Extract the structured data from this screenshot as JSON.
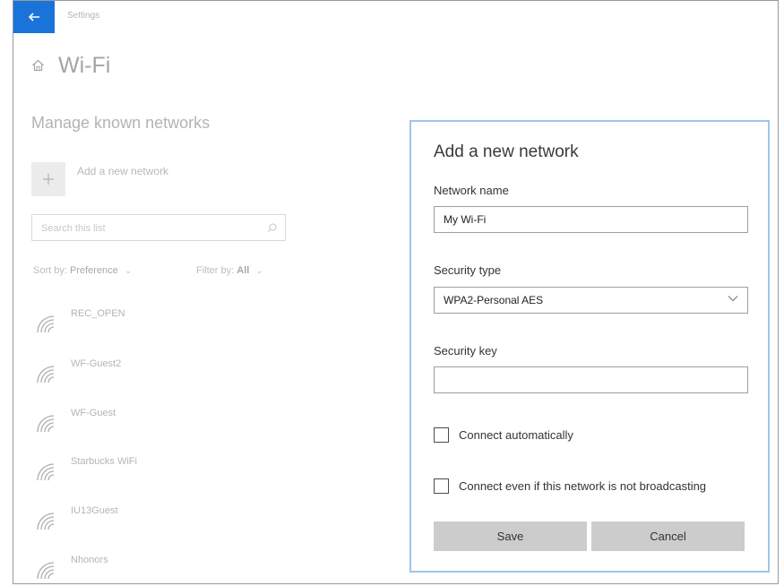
{
  "window": {
    "title": "Settings"
  },
  "page": {
    "title": "Wi-Fi"
  },
  "manage": {
    "heading": "Manage known networks",
    "add_label": "Add a new network",
    "search_placeholder": "Search this list",
    "sort_label": "Sort by:",
    "sort_value": "Preference",
    "filter_label": "Filter by:",
    "filter_value": "All",
    "networks": [
      {
        "name": "REC_OPEN"
      },
      {
        "name": "WF-Guest2"
      },
      {
        "name": "WF-Guest"
      },
      {
        "name": "Starbucks WiFi"
      },
      {
        "name": "IU13Guest"
      },
      {
        "name": "Nhonors"
      }
    ]
  },
  "dialog": {
    "title": "Add a new network",
    "network_name_label": "Network name",
    "network_name_value": "My Wi-Fi",
    "security_type_label": "Security type",
    "security_type_value": "WPA2-Personal AES",
    "security_key_label": "Security key",
    "security_key_value": "",
    "connect_auto_label": "Connect automatically",
    "connect_broadcast_label": "Connect even if this network is not broadcasting",
    "save_label": "Save",
    "cancel_label": "Cancel"
  },
  "colors": {
    "accent": "#1a73d9",
    "dialog_border": "#9fc5e8",
    "button_bg": "#cccccc"
  },
  "icons": [
    "back-arrow-icon",
    "home-icon",
    "plus-icon",
    "search-icon",
    "chevron-down-icon",
    "wifi-icon"
  ]
}
